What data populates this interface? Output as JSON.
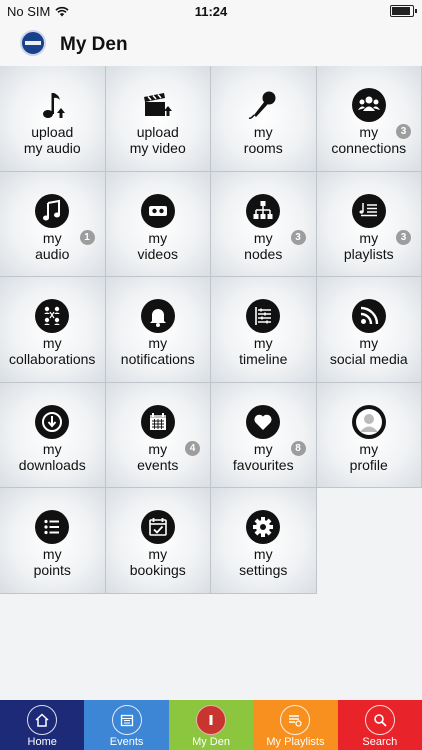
{
  "status": {
    "carrier": "No SIM",
    "time": "11:24"
  },
  "header": {
    "title": "My Den"
  },
  "tiles": [
    {
      "l1": "upload",
      "l2": "my audio",
      "badge": ""
    },
    {
      "l1": "upload",
      "l2": "my video",
      "badge": ""
    },
    {
      "l1": "my",
      "l2": "rooms",
      "badge": ""
    },
    {
      "l1": "my",
      "l2": "connections",
      "badge": "3"
    },
    {
      "l1": "my",
      "l2": "audio",
      "badge": "1"
    },
    {
      "l1": "my",
      "l2": "videos",
      "badge": ""
    },
    {
      "l1": "my",
      "l2": "nodes",
      "badge": "3"
    },
    {
      "l1": "my",
      "l2": "playlists",
      "badge": "3"
    },
    {
      "l1": "my",
      "l2": "collaborations",
      "badge": ""
    },
    {
      "l1": "my",
      "l2": "notifications",
      "badge": ""
    },
    {
      "l1": "my",
      "l2": "timeline",
      "badge": ""
    },
    {
      "l1": "my",
      "l2": "social media",
      "badge": ""
    },
    {
      "l1": "my",
      "l2": "downloads",
      "badge": ""
    },
    {
      "l1": "my",
      "l2": "events",
      "badge": "4"
    },
    {
      "l1": "my",
      "l2": "favourites",
      "badge": "8"
    },
    {
      "l1": "my",
      "l2": "profile",
      "badge": ""
    },
    {
      "l1": "my",
      "l2": "points",
      "badge": ""
    },
    {
      "l1": "my",
      "l2": "bookings",
      "badge": ""
    },
    {
      "l1": "my",
      "l2": "settings",
      "badge": ""
    }
  ],
  "tabs": [
    {
      "label": "Home",
      "color": "#1c2a78"
    },
    {
      "label": "Events",
      "color": "#3d86d6"
    },
    {
      "label": "My Den",
      "color": "#8cc63f"
    },
    {
      "label": "My Playlists",
      "color": "#f7901e"
    },
    {
      "label": "Search",
      "color": "#e8242a"
    }
  ]
}
